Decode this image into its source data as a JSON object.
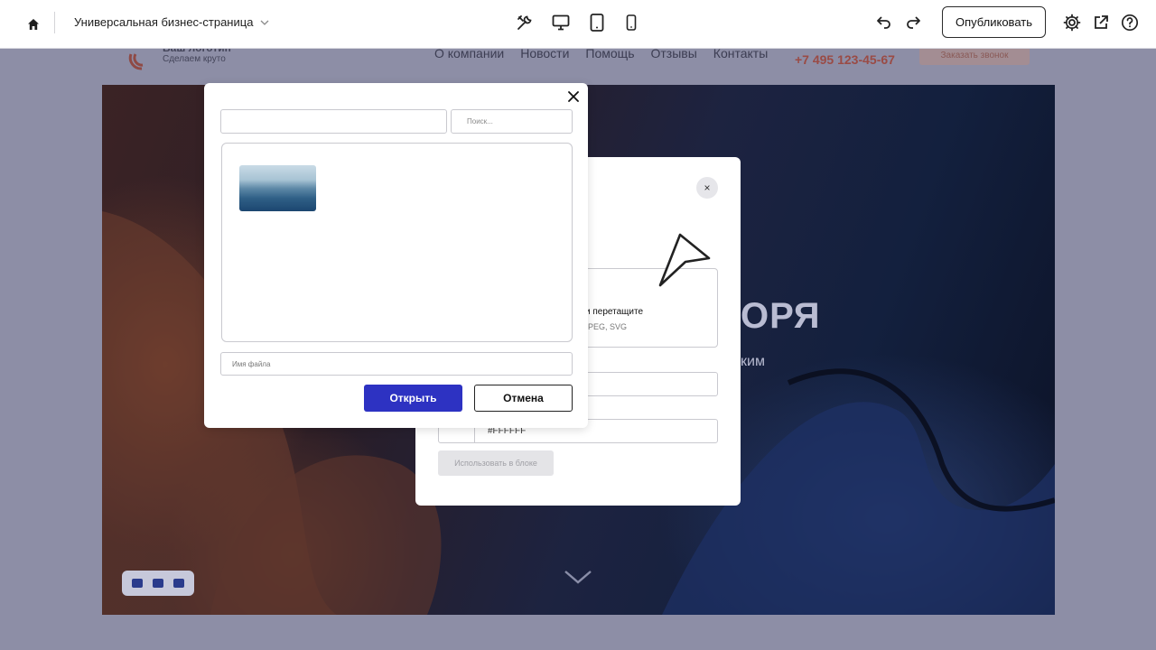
{
  "toolbar": {
    "page_name": "Универсальная бизнес-страница",
    "publish_label": "Опубликовать",
    "icons": [
      "home-icon",
      "chevron-down-icon",
      "tools-icon",
      "desktop-icon",
      "tablet-icon",
      "mobile-icon",
      "undo-icon",
      "redo-icon",
      "settings-icon",
      "external-link-icon",
      "help-icon"
    ]
  },
  "site": {
    "logo_title": "Ваш логотип",
    "logo_subtitle": "Сделаем круто",
    "nav": [
      "О компании",
      "Новости",
      "Помощь",
      "Отзывы",
      "Контакты"
    ],
    "phone": "+7 495 123-45-67",
    "callback_label": "Заказать звонок",
    "hero_title_visible": "ОРЯ",
    "hero_subtitle_visible": "ким"
  },
  "image_dialog": {
    "close_label": "×",
    "upload_text": "и перетащите",
    "upload_hint": "PEG, SVG",
    "color_value": "#FFFFFF",
    "use_label": "Использовать в блоке"
  },
  "file_dialog": {
    "search_placeholder": "Поиск...",
    "filename_placeholder": "Имя файла",
    "open_label": "Открыть",
    "cancel_label": "Отмена"
  },
  "colors": {
    "primary_button": "#2d32c2",
    "overlay": "#8d8ea6"
  }
}
